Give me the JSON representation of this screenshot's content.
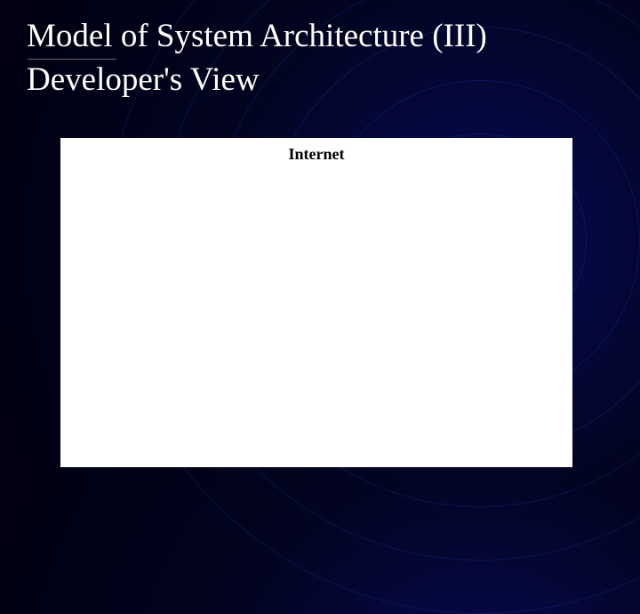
{
  "slide": {
    "title_line1": "Model of System Architecture (III)",
    "title_line2": "Developer's View",
    "content_label": "Internet"
  }
}
